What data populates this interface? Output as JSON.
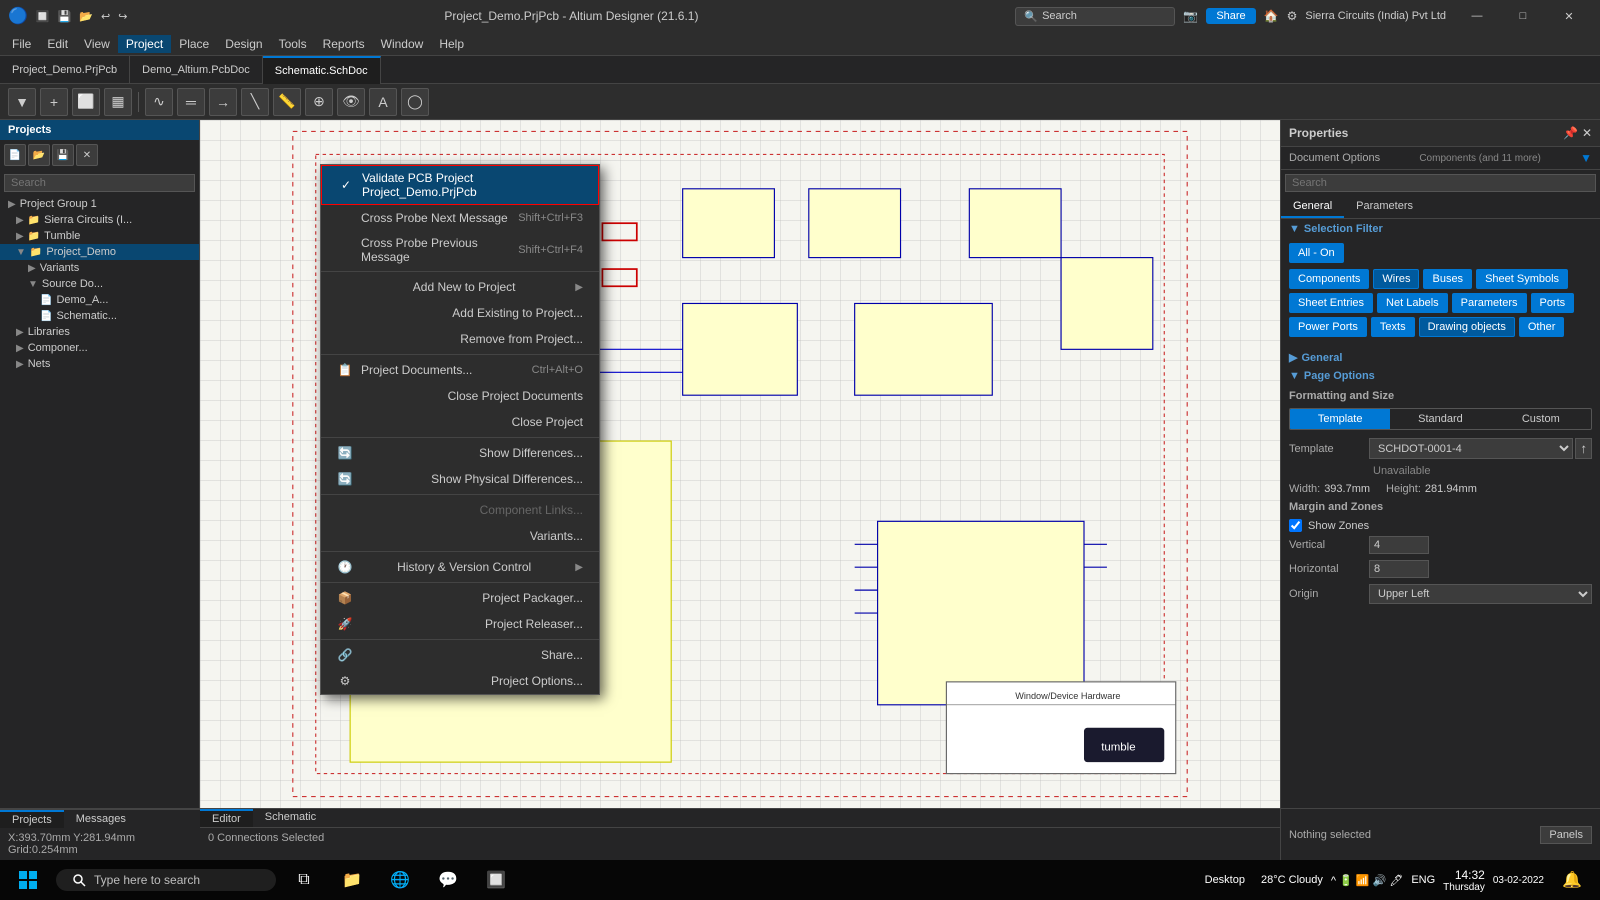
{
  "titlebar": {
    "title": "Project_Demo.PrjPcb - Altium Designer (21.6.1)",
    "search_placeholder": "Search",
    "share_label": "Share",
    "user": "Sierra Circuits (India) Pvt Ltd",
    "win_minimize": "—",
    "win_maximize": "□",
    "win_close": "✕"
  },
  "menubar": {
    "items": [
      "File",
      "Edit",
      "View",
      "Project",
      "Place",
      "Design",
      "Tools",
      "Reports",
      "Window",
      "Help"
    ]
  },
  "tabs": [
    {
      "label": "Project_Demo.PrjPcb",
      "active": false
    },
    {
      "label": "Demo_Altium.PcbDoc",
      "active": false
    },
    {
      "label": "Schematic.SchDoc",
      "active": true
    }
  ],
  "sidebar": {
    "title": "Projects",
    "search_placeholder": "Search",
    "tree": [
      {
        "level": 0,
        "label": "Project Group 1",
        "icon": "▶",
        "type": "group"
      },
      {
        "level": 1,
        "label": "Sierra Circuits (I...",
        "icon": "▶",
        "type": "folder"
      },
      {
        "level": 1,
        "label": "Tumble",
        "icon": "▶",
        "type": "folder"
      },
      {
        "level": 1,
        "label": "Project_Demo",
        "icon": "▼",
        "type": "project",
        "selected": true
      },
      {
        "level": 2,
        "label": "Variants",
        "icon": "▶",
        "type": "folder"
      },
      {
        "level": 2,
        "label": "Source Do...",
        "icon": "▼",
        "type": "folder"
      },
      {
        "level": 3,
        "label": "Demo_A...",
        "icon": "📄",
        "type": "file"
      },
      {
        "level": 3,
        "label": "Schematic...",
        "icon": "📄",
        "type": "file"
      },
      {
        "level": 1,
        "label": "Libraries",
        "icon": "▶",
        "type": "folder"
      },
      {
        "level": 1,
        "label": "Componer...",
        "icon": "▶",
        "type": "folder"
      },
      {
        "level": 1,
        "label": "Nets",
        "icon": "▶",
        "type": "folder"
      }
    ]
  },
  "dropdown_menu": {
    "items": [
      {
        "id": "validate",
        "label": "Validate PCB Project Project_Demo.PrjPcb",
        "icon": "✓",
        "highlighted": true
      },
      {
        "id": "cross-next",
        "label": "Cross Probe Next Message",
        "shortcut": "Shift+Ctrl+F3",
        "icon": ""
      },
      {
        "id": "cross-prev",
        "label": "Cross Probe Previous Message",
        "shortcut": "Shift+Ctrl+F4",
        "icon": ""
      },
      {
        "id": "sep1",
        "separator": true
      },
      {
        "id": "add-new",
        "label": "Add New to Project",
        "arrow": true,
        "icon": ""
      },
      {
        "id": "add-existing",
        "label": "Add Existing to Project...",
        "icon": ""
      },
      {
        "id": "remove",
        "label": "Remove from Project...",
        "icon": ""
      },
      {
        "id": "sep2",
        "separator": true
      },
      {
        "id": "project-docs",
        "label": "Project Documents...",
        "shortcut": "Ctrl+Alt+O",
        "icon": "📋"
      },
      {
        "id": "close-docs",
        "label": "Close Project Documents",
        "icon": ""
      },
      {
        "id": "close-project",
        "label": "Close Project",
        "icon": ""
      },
      {
        "id": "sep3",
        "separator": true
      },
      {
        "id": "show-diff",
        "label": "Show Differences...",
        "icon": "🔄"
      },
      {
        "id": "show-phys",
        "label": "Show Physical Differences...",
        "icon": "🔄"
      },
      {
        "id": "sep4",
        "separator": true
      },
      {
        "id": "comp-links",
        "label": "Component Links...",
        "icon": "",
        "disabled": true
      },
      {
        "id": "variants",
        "label": "Variants...",
        "icon": ""
      },
      {
        "id": "sep5",
        "separator": true
      },
      {
        "id": "history",
        "label": "History & Version Control",
        "arrow": true,
        "icon": "🕐"
      },
      {
        "id": "sep6",
        "separator": true
      },
      {
        "id": "packager",
        "label": "Project Packager...",
        "icon": "📦"
      },
      {
        "id": "releaser",
        "label": "Project Releaser...",
        "icon": "🚀"
      },
      {
        "id": "sep7",
        "separator": true
      },
      {
        "id": "share",
        "label": "Share...",
        "icon": "🔗"
      },
      {
        "id": "options",
        "label": "Project Options...",
        "icon": "⚙"
      }
    ]
  },
  "properties": {
    "title": "Properties",
    "doc_options": "Document Options",
    "doc_options_badge": "Components (and 11 more)",
    "search_placeholder": "Search",
    "tabs": [
      "General",
      "Parameters"
    ],
    "active_tab": "General",
    "selection_filter": {
      "title": "Selection Filter",
      "all_on": "All - On",
      "buttons": [
        {
          "label": "Components",
          "active": true
        },
        {
          "label": "Wires",
          "active": true,
          "highlight": true
        },
        {
          "label": "Buses",
          "active": true
        },
        {
          "label": "Sheet Symbols",
          "active": true
        },
        {
          "label": "Sheet Entries",
          "active": true
        },
        {
          "label": "Net Labels",
          "active": true
        },
        {
          "label": "Parameters",
          "active": true
        },
        {
          "label": "Ports",
          "active": true
        },
        {
          "label": "Power Ports",
          "active": true
        },
        {
          "label": "Texts",
          "active": true
        },
        {
          "label": "Drawing objects",
          "active": true,
          "highlight": true
        },
        {
          "label": "Other",
          "active": true
        }
      ]
    },
    "general_section": "General",
    "page_options": {
      "title": "Page Options",
      "formatting": {
        "title": "Formatting and Size",
        "tabs": [
          "Template",
          "Standard",
          "Custom"
        ],
        "active": "Template",
        "template_label": "Template",
        "template_value": "SCHDOT-0001-4",
        "unavailable": "Unavailable",
        "width_label": "Width:",
        "width_value": "393.7mm",
        "height_label": "Height:",
        "height_value": "281.94mm"
      },
      "margin_zones": {
        "title": "Margin and Zones",
        "show_zones": true,
        "show_zones_label": "Show Zones",
        "vertical_label": "Vertical",
        "vertical_value": "4",
        "horizontal_label": "Horizontal",
        "horizontal_value": "8",
        "origin_label": "Origin",
        "origin_value": "Upper Left"
      }
    }
  },
  "statusbar": {
    "coords": "X:393.70mm Y:281.94mm",
    "grid": "Grid:0.254mm",
    "connections": "0 Connections Selected",
    "nothing_selected": "Nothing selected",
    "panels": "Panels"
  },
  "bottom_tabs": [
    "Projects",
    "Messages"
  ],
  "editor_tabs": [
    "Editor",
    "Schematic"
  ],
  "taskbar": {
    "search_placeholder": "Type here to search",
    "time": "14:32",
    "date": "Thursday",
    "date2": "03-02-2022",
    "weather": "28°C  Cloudy",
    "desktop": "Desktop",
    "language": "ENG"
  }
}
